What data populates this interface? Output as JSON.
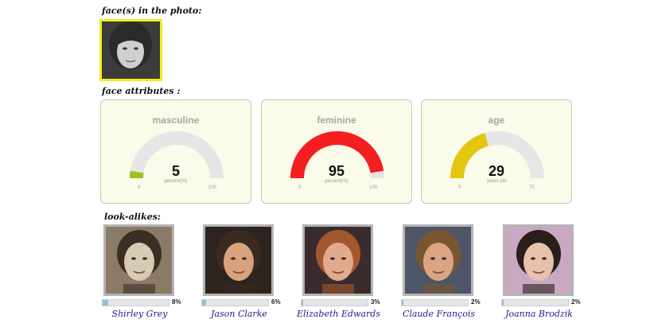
{
  "labels": {
    "faces_heading": "face(s) in the photo:",
    "attributes_heading": "face attributes :",
    "lookalikes_heading": "look-alikes:"
  },
  "colors": {
    "face_border": "#f3ee14",
    "gauge_track": "#e6e6e6",
    "gauge_card_bg": "#fbfbe9",
    "masculine": "#9dc21c",
    "feminine": "#f41f1f",
    "age": "#e3c60f",
    "match_bar": "#8fc3dc",
    "name_link": "#1d1d8f"
  },
  "gauges": [
    {
      "title": "masculine",
      "value": "5",
      "unit": "percent(%)",
      "min": "0",
      "max": "100",
      "fraction": 0.05,
      "color_key": "masculine"
    },
    {
      "title": "feminine",
      "value": "95",
      "unit": "percent(%)",
      "min": "0",
      "max": "100",
      "fraction": 0.95,
      "color_key": "feminine"
    },
    {
      "title": "age",
      "value": "29",
      "unit": "years old",
      "min": "0",
      "max": "70",
      "fraction": 0.414,
      "color_key": "age"
    }
  ],
  "lookalikes": [
    {
      "name": "Shirley Grey",
      "percent": "8%",
      "fraction": 0.08
    },
    {
      "name": "Jason Clarke",
      "percent": "6%",
      "fraction": 0.06
    },
    {
      "name": "Elizabeth Edwards",
      "percent": "3%",
      "fraction": 0.03
    },
    {
      "name": "Claude François",
      "percent": "2%",
      "fraction": 0.02
    },
    {
      "name": "Joanna Brodzik",
      "percent": "2%",
      "fraction": 0.02
    }
  ]
}
